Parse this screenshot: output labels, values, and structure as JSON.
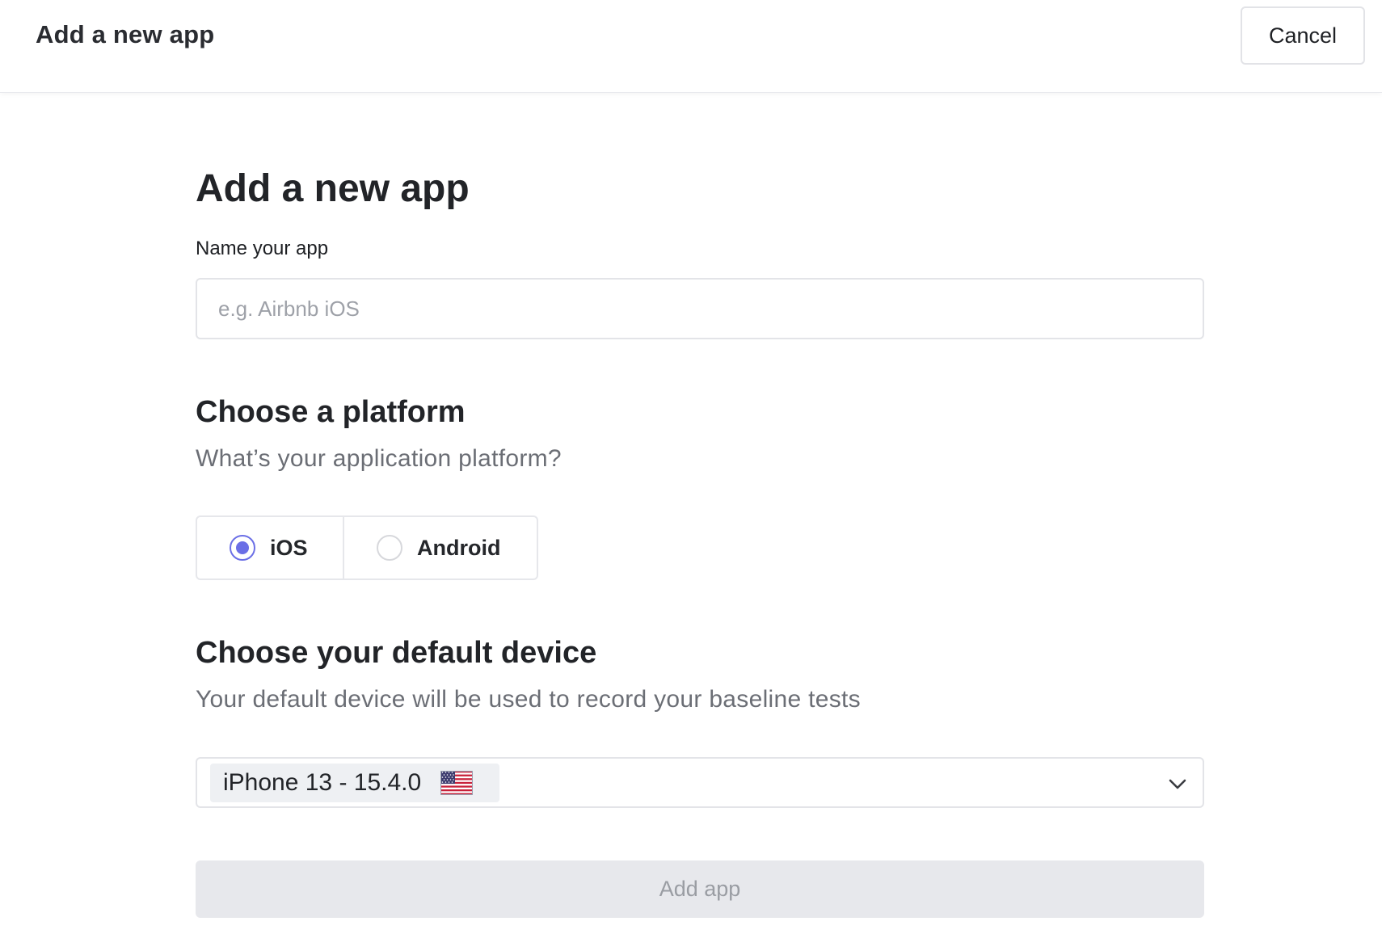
{
  "header": {
    "title": "Add a new app",
    "cancel_label": "Cancel"
  },
  "form": {
    "page_title": "Add a new app",
    "name_label": "Name your app",
    "name_placeholder": "e.g. Airbnb iOS",
    "name_value": "",
    "platform": {
      "title": "Choose a platform",
      "subtitle": "What’s your application platform?",
      "options": [
        {
          "label": "iOS",
          "selected": true
        },
        {
          "label": "Android",
          "selected": false
        }
      ]
    },
    "device": {
      "title": "Choose your default device",
      "subtitle": "Your default device will be used to record your baseline tests",
      "selected": "iPhone 13 - 15.4.0",
      "flag_icon": "us-flag-icon",
      "dropdown_icon": "chevron-down-icon"
    },
    "submit_label": "Add app",
    "submit_enabled": false
  },
  "colors": {
    "accent": "#6b6fe6",
    "disabled_button_bg": "#e7e8ec",
    "disabled_button_text": "#9a9da3",
    "subtitle_text": "#6b6e75"
  }
}
